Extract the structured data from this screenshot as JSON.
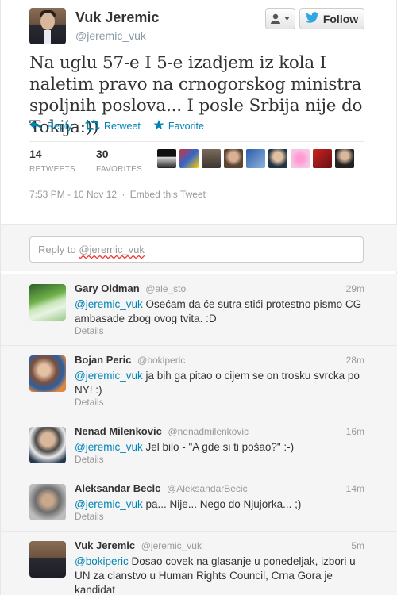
{
  "author": {
    "name": "Vuk Jeremic",
    "handle": "@jeremic_vuk"
  },
  "buttons": {
    "follow_label": "Follow"
  },
  "tweet": {
    "text": "Na uglu 57-e I 5-e izadjem iz kola I naletim pravo na crnogorskog ministra spoljnih poslova... I posle Srbija nije do Tokija:))",
    "actions": {
      "reply": "Reply",
      "retweet": "Retweet",
      "favorite": "Favorite"
    },
    "retweets_count": "14",
    "retweets_label": "RETWEETS",
    "favorites_count": "30",
    "favorites_label": "FAVORITES",
    "timestamp": "7:53 PM - 10 Nov 12",
    "separator": "·",
    "embed": "Embed this Tweet"
  },
  "reply_box": {
    "placeholder_prefix": "Reply to ",
    "placeholder_handle": "@jeremic_vuk"
  },
  "replies": [
    {
      "name": "Gary Oldman",
      "handle": "@ale_sto",
      "time": "29m",
      "mention": "@jeremic_vuk",
      "text": " Osećam da će sutra stići protestno pismo CG ambasade zbog ovog tvita. :D",
      "details": "Details"
    },
    {
      "name": "Bojan Peric",
      "handle": "@bokiperic",
      "time": "28m",
      "mention": "@jeremic_vuk",
      "text": " ja bih ga pitao o cijem se on trosku svrcka po NY! :)",
      "details": "Details"
    },
    {
      "name": "Nenad Milenkovic",
      "handle": "@nenadmilenkovic",
      "time": "16m",
      "mention": "@jeremic_vuk",
      "text": " Jel bilo - \"A gde si ti pošao?\" :-)",
      "details": "Details"
    },
    {
      "name": "Aleksandar Becic",
      "handle": "@AleksandarBecic",
      "time": "14m",
      "mention": "@jeremic_vuk",
      "text": " pa... Nije... Nego do Njujorka... ;)",
      "details": "Details"
    },
    {
      "name": "Vuk Jeremic",
      "handle": "@jeremic_vuk",
      "time": "5m",
      "mention": "@bokiperic",
      "text": " Dosao covek na glasanje u ponedeljak, izbori u UN za clanstvo u Human Rights Council, Crna Gora je kandidat",
      "details": ""
    }
  ],
  "colors": {
    "link": "#0084b4",
    "follow_bird": "#2fa7e1",
    "background_secondary": "#f5f5f5"
  }
}
